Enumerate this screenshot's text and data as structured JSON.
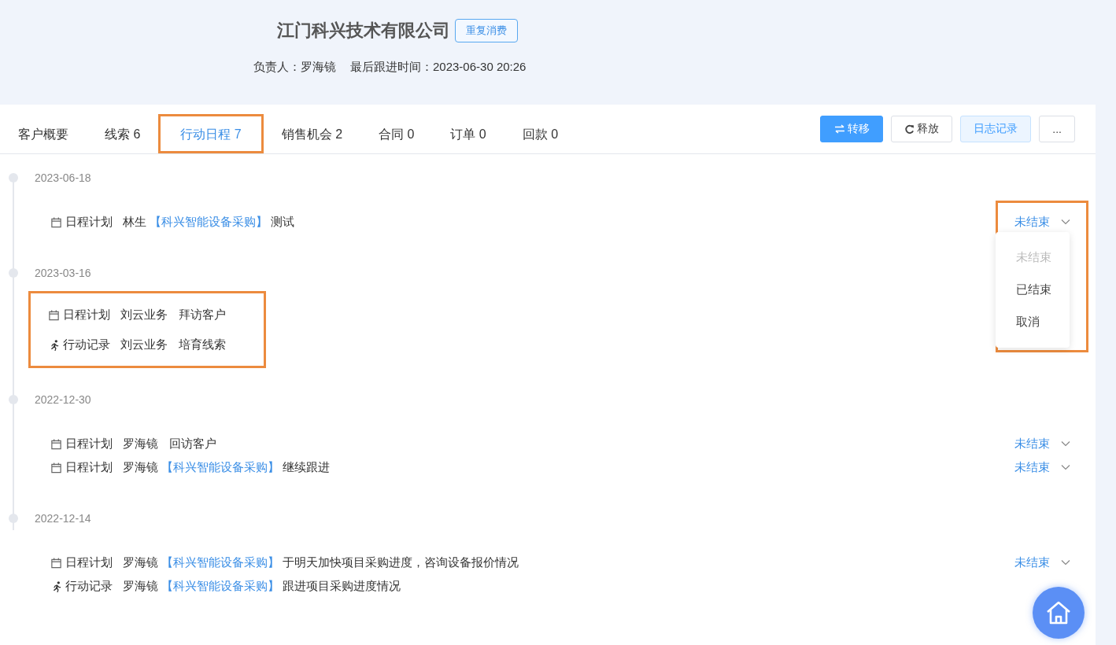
{
  "header": {
    "company": "江门科兴技术有限公司",
    "tag": "重复消费",
    "owner_label": "负责人：",
    "owner": "罗海镜",
    "last_follow_label": "最后跟进时间：",
    "last_follow": "2023-06-30 20:26"
  },
  "tabs": [
    {
      "label": "客户概要",
      "selected": false,
      "highlighted": false
    },
    {
      "label": "线索 6",
      "selected": false,
      "highlighted": false
    },
    {
      "label": "行动日程 7",
      "selected": true,
      "highlighted": true
    },
    {
      "label": "销售机会 2",
      "selected": false,
      "highlighted": false
    },
    {
      "label": "合同 0",
      "selected": false,
      "highlighted": false
    },
    {
      "label": "订单 0",
      "selected": false,
      "highlighted": false
    },
    {
      "label": "回款 0",
      "selected": false,
      "highlighted": false
    }
  ],
  "actions": [
    {
      "kind": "transfer",
      "label": "转移"
    },
    {
      "kind": "release",
      "label": "释放"
    },
    {
      "kind": "log",
      "label": "日志记录"
    },
    {
      "kind": "more",
      "label": "..."
    }
  ],
  "timeline": [
    {
      "date": "2023-06-18",
      "highlighted": false,
      "entries": [
        {
          "kind": "plan",
          "type_label": "日程计划",
          "person": "林生",
          "project": "【科兴智能设备采购】",
          "content": "测试",
          "status": {
            "value": "未结束",
            "highlighted": true,
            "options": [
              {
                "label": "未结束",
                "selected": true
              },
              {
                "label": "已结束",
                "selected": false
              },
              {
                "label": "取消",
                "selected": false
              }
            ]
          }
        }
      ]
    },
    {
      "date": "2023-03-16",
      "highlighted": true,
      "entries": [
        {
          "kind": "plan",
          "type_label": "日程计划",
          "person": "刘云业务",
          "content": "拜访客户"
        },
        {
          "kind": "record",
          "type_label": "行动记录",
          "person": "刘云业务",
          "content": "培育线索"
        }
      ]
    },
    {
      "date": "2022-12-30",
      "highlighted": false,
      "entries": [
        {
          "kind": "plan",
          "type_label": "日程计划",
          "person": "罗海镜",
          "content": "回访客户",
          "status": {
            "value": "未结束"
          }
        },
        {
          "kind": "plan",
          "type_label": "日程计划",
          "person": "罗海镜",
          "project": "【科兴智能设备采购】",
          "content": "继续跟进",
          "status": {
            "value": "未结束"
          }
        }
      ]
    },
    {
      "date": "2022-12-14",
      "highlighted": false,
      "entries": [
        {
          "kind": "plan",
          "type_label": "日程计划",
          "person": "罗海镜",
          "project": "【科兴智能设备采购】",
          "content": "于明天加快项目采购进度，咨询设备报价情况",
          "status": {
            "value": "未结束"
          }
        },
        {
          "kind": "record",
          "type_label": "行动记录",
          "person": "罗海镜",
          "project": "【科兴智能设备采购】",
          "content": "跟进项目采购进度情况"
        }
      ]
    }
  ]
}
